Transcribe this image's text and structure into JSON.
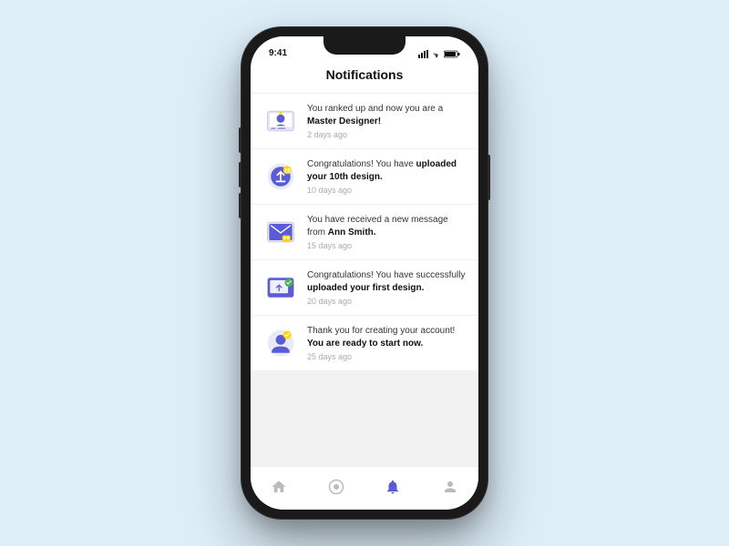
{
  "phone": {
    "status": {
      "time": "9:41"
    },
    "header": {
      "title": "Notifications"
    },
    "notifications": [
      {
        "id": 1,
        "text_plain": "You ranked up and now you are a ",
        "text_bold": "Master Designer!",
        "time": "2 days ago",
        "icon": "rank"
      },
      {
        "id": 2,
        "text_plain": "Congratulations! You have ",
        "text_bold": "uploaded your 10th design.",
        "time": "10 days ago",
        "icon": "upload"
      },
      {
        "id": 3,
        "text_plain": "You have received a new message from ",
        "text_bold": "Ann Smith.",
        "time": "15 days ago",
        "icon": "message"
      },
      {
        "id": 4,
        "text_plain": "Congratulations! You have successfully ",
        "text_bold": "uploaded your first design.",
        "time": "20 days ago",
        "icon": "first-upload"
      },
      {
        "id": 5,
        "text_plain": "Thank you for creating your account! ",
        "text_bold": "You are ready to start now.",
        "time": "25 days ago",
        "icon": "account"
      }
    ],
    "nav": {
      "items": [
        {
          "label": "home",
          "icon": "home",
          "active": false
        },
        {
          "label": "activity",
          "icon": "activity",
          "active": false
        },
        {
          "label": "notifications",
          "icon": "bell",
          "active": true
        },
        {
          "label": "profile",
          "icon": "person",
          "active": false
        }
      ]
    }
  }
}
